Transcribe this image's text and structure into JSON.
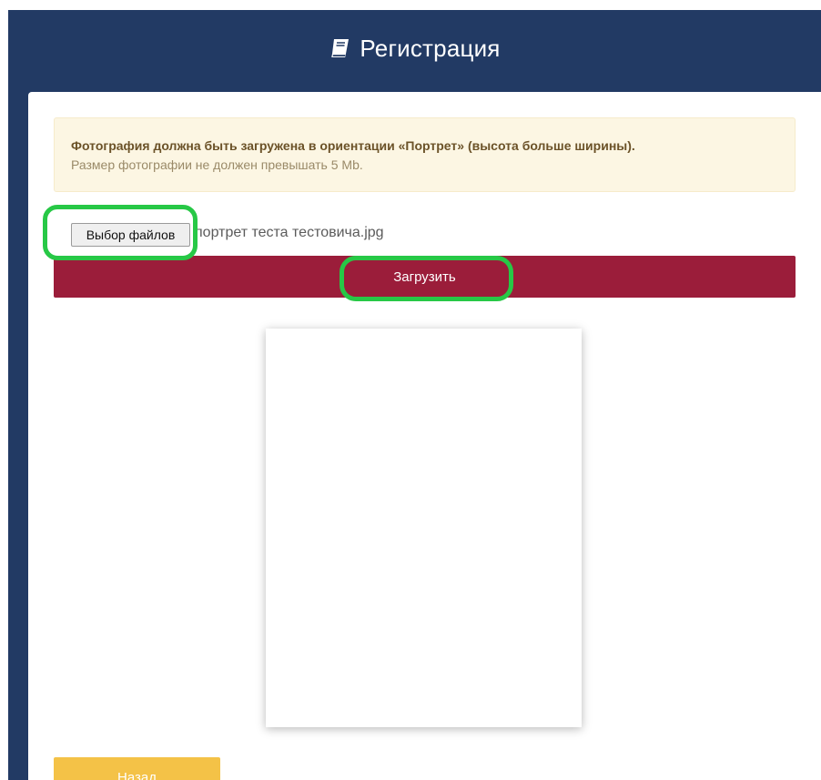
{
  "header": {
    "title": "Регистрация",
    "icon": "book-icon"
  },
  "alert": {
    "message_bold": "Фотография должна быть загружена в ориентации «Портрет» (высота больше ширины).",
    "message": "Размер фотографии не должен превышать 5 Mb."
  },
  "file_input": {
    "button_label": "Выбор файлов",
    "selected_file": "портрет теста тестовича.jpg"
  },
  "upload": {
    "label": "Загрузить"
  },
  "back": {
    "label": "Назад"
  },
  "colors": {
    "header_bg": "#223a64",
    "upload_bg": "#9b1d3a",
    "back_bg": "#f4c247",
    "highlight": "#27c846",
    "alert_bg": "#fcf6e3"
  }
}
